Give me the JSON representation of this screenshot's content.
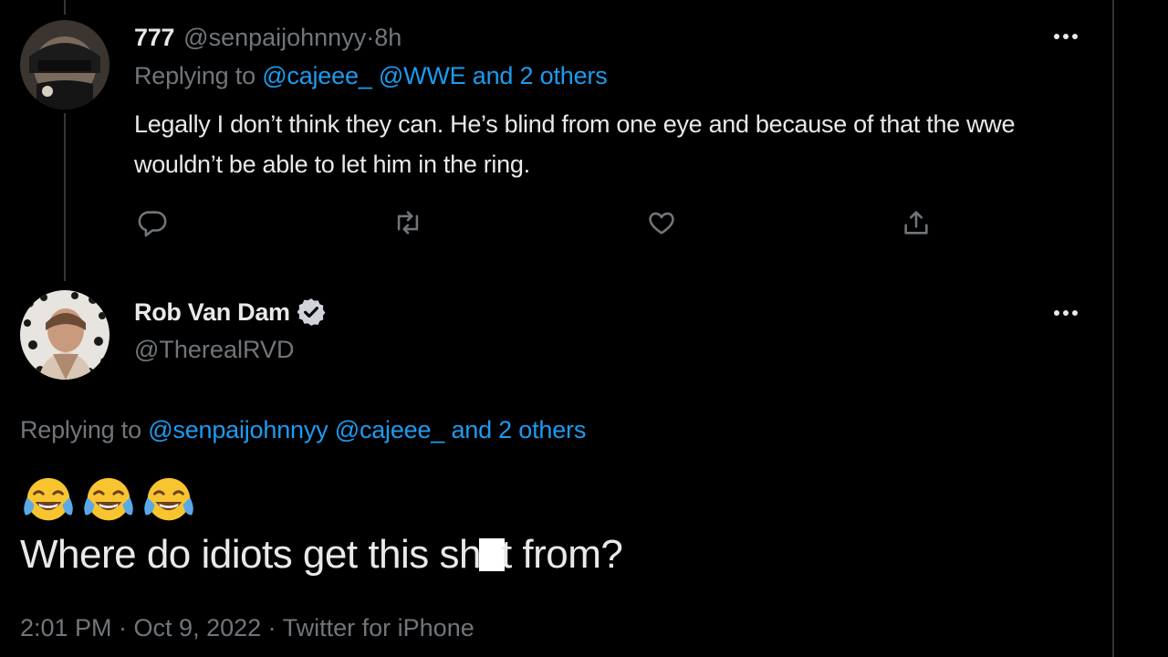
{
  "tweet1": {
    "display_name": "777",
    "handle": "@senpaijohnnyy",
    "separator": " · ",
    "time": "8h",
    "replying_prefix": "Replying to ",
    "replying_to": [
      "@cajeee_",
      "@WWE",
      "and 2 others"
    ],
    "text": "Legally I don’t think they can. He’s blind from one eye and because of that the wwe wouldn’t be able to let him in the ring.",
    "actions": [
      "reply-icon",
      "retweet-icon",
      "like-icon",
      "share-icon"
    ]
  },
  "tweet2": {
    "display_name": "Rob Van Dam",
    "verified": true,
    "handle": "@TherealRVD",
    "replying_prefix": "Replying to ",
    "replying_to": [
      "@senpaijohnnyy",
      "@cajeee_",
      "and 2 others"
    ],
    "emojis": [
      "face-with-tears-of-joy",
      "face-with-tears-of-joy",
      "face-with-tears-of-joy"
    ],
    "text_before_censor": "Where do idiots get this sh",
    "text_after_censor": "t from?",
    "timestamp": "2:01 PM · Oct 9, 2022 · Twitter for iPhone"
  },
  "colors": {
    "background": "#000000",
    "text": "#e7e9ea",
    "muted": "#71767b",
    "link": "#1d9bf0",
    "divider": "#2f3336"
  }
}
